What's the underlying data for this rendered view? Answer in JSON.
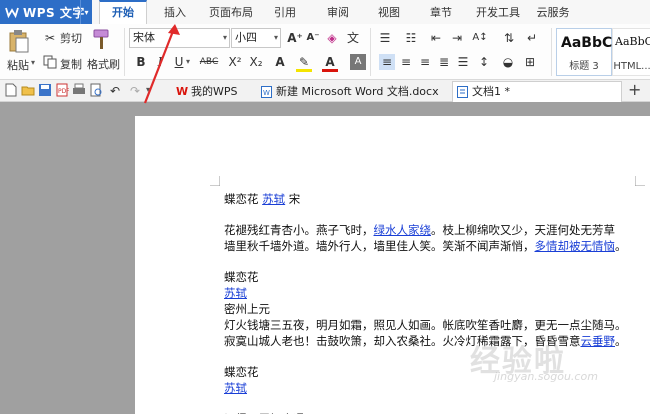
{
  "app": {
    "name": "WPS 文字",
    "menu_tabs": [
      "开始",
      "插入",
      "页面布局",
      "引用",
      "审阅",
      "视图",
      "章节",
      "开发工具",
      "云服务"
    ],
    "active_tab": "开始"
  },
  "ribbon": {
    "paste_label": "粘贴",
    "cut_label": "剪切",
    "copy_label": "复制",
    "format_painter_label": "格式刷",
    "font_family": "宋体",
    "font_size": "小四",
    "bold": "B",
    "italic": "I",
    "underline": "U",
    "strike": "ABC",
    "superscript": "X²",
    "subscript": "X₂",
    "grow_font": "A⁺",
    "shrink_font": "A⁻",
    "font_color": "A",
    "font_color_hex": "#d9140c",
    "highlight_hex": "#f4e400",
    "style_normal_sample": "AaBbC",
    "style_normal_caption": "标题 3",
    "style_html_sample": "AaBbC",
    "style_html_caption": "HTML..."
  },
  "tabs": [
    {
      "label": "我的WPS",
      "icon": "wps-home-icon",
      "active": false
    },
    {
      "label": "新建 Microsoft Word 文档.docx",
      "icon": "word-doc-icon",
      "active": false
    },
    {
      "label": "文档1 *",
      "icon": "doc-icon",
      "active": true
    }
  ],
  "document": {
    "lines": [
      {
        "parts": [
          {
            "t": "蝶恋花 "
          },
          {
            "t": "苏轼",
            "link": true
          },
          {
            "t": " 宋"
          }
        ]
      },
      {
        "parts": [
          {
            "t": "花褪残红青杏小。燕子飞时，"
          },
          {
            "t": "绿水人家绕",
            "link": true
          },
          {
            "t": "。枝上柳绵吹又少，天涯何处无芳草"
          }
        ]
      },
      {
        "parts": [
          {
            "t": "墙里秋千墙外道。墙外行人，墙里佳人笑。笑渐不闻声渐悄，"
          },
          {
            "t": "多情却被无情恼",
            "link": true
          },
          {
            "t": "。"
          }
        ]
      },
      {
        "parts": [
          {
            "t": "蝶恋花"
          }
        ]
      },
      {
        "parts": [
          {
            "t": "苏轼",
            "link": true
          }
        ]
      },
      {
        "parts": [
          {
            "t": "密州上元"
          }
        ]
      },
      {
        "parts": [
          {
            "t": "灯火钱塘三五夜，明月如霜，照见人如画。帐底吹笙香吐麝，更无一点尘随马。"
          }
        ]
      },
      {
        "parts": [
          {
            "t": "寂寞山城人老也！击鼓吹箫，却入农桑社。火冷灯稀霜露下，昏昏雪意"
          },
          {
            "t": "云垂野",
            "link": true
          },
          {
            "t": "。"
          }
        ]
      },
      {
        "parts": [
          {
            "t": "蝶恋花"
          }
        ]
      },
      {
        "parts": [
          {
            "t": "苏轼",
            "link": true
          }
        ]
      },
      {
        "parts": [
          {
            "t": "记得画屏初会遇"
          }
        ]
      }
    ]
  },
  "watermark": {
    "main": "经验啦",
    "sub": "jingyan.sogou.com"
  },
  "colors": {
    "app_blue": "#2d6ec7",
    "link_blue": "#1a3fd6",
    "annotation_red": "#e02a2a"
  }
}
